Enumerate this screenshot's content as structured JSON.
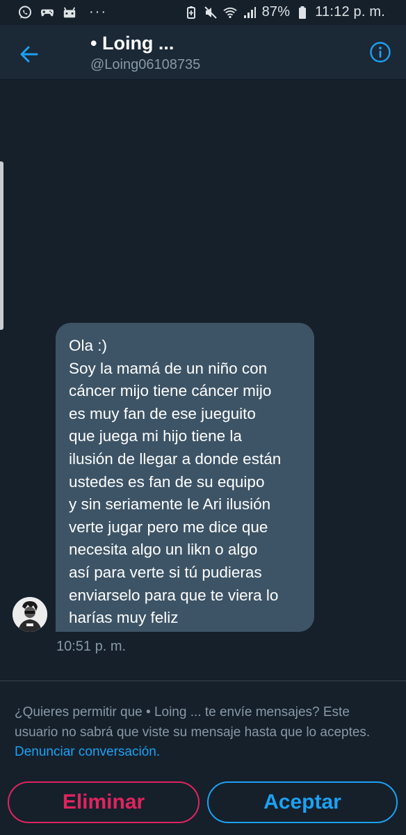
{
  "status_bar": {
    "battery": "87%",
    "time": "11:12 p. m.",
    "more": "···"
  },
  "header": {
    "title": "• Loing ...",
    "handle": "@Loing06108735"
  },
  "message": {
    "lines": [
      "Ola :)",
      "Soy la mamá de un niño con",
      "cáncer mijo tiene cáncer mijo",
      "es muy fan de ese jueguito",
      "que juega mi hijo tiene la",
      "ilusión de llegar a donde están",
      "ustedes es fan de su equipo",
      "y sin seriamente le Ari ilusión",
      "verte jugar pero me dice que",
      "necesita algo un likn o algo",
      "así para verte si tú pudieras",
      "enviarselo para que te viera lo",
      "harías muy feliz"
    ],
    "time": "10:51 p. m."
  },
  "request": {
    "text": "¿Quieres permitir que • Loing ... te envíe mensajes? Este usuario no sabrá que viste su mensaje hasta que lo aceptes.",
    "report_link": "Denunciar conversación."
  },
  "actions": {
    "delete": "Eliminar",
    "accept": "Aceptar"
  },
  "colors": {
    "background": "#15202b",
    "header": "#1b2836",
    "bubble": "#3d5466",
    "accent": "#1da1f2",
    "danger": "#e0245e",
    "muted": "#8899a6"
  }
}
